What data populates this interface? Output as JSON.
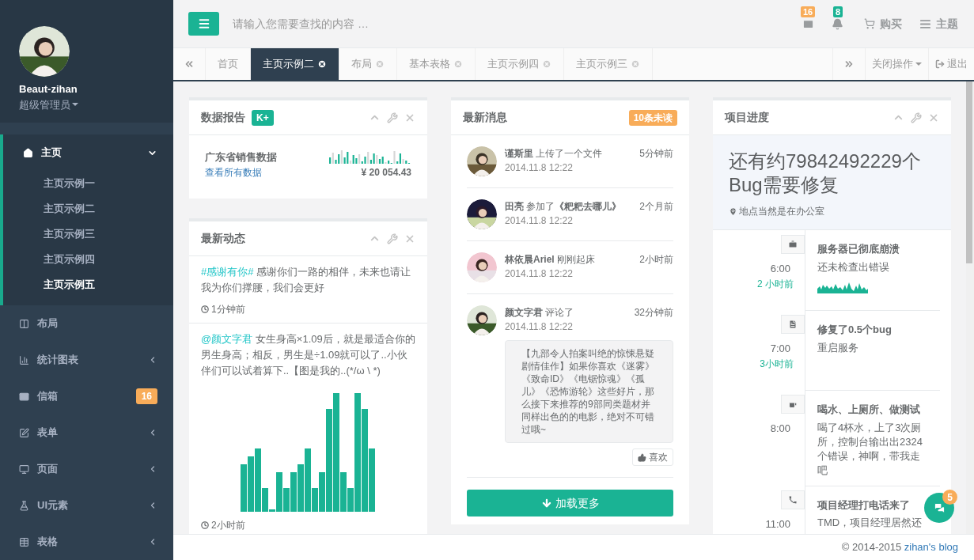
{
  "sidebar": {
    "profile": {
      "name": "Beaut-zihan",
      "role": "超级管理员"
    },
    "items": [
      {
        "label": "主页",
        "selected": true,
        "expanded": true,
        "children": [
          {
            "label": "主页示例一",
            "selected": false
          },
          {
            "label": "主页示例二",
            "selected": false
          },
          {
            "label": "主页示例三",
            "selected": false
          },
          {
            "label": "主页示例四",
            "selected": false
          },
          {
            "label": "主页示例五",
            "selected": true
          }
        ]
      },
      {
        "label": "布局",
        "selected": false,
        "expanded": false
      },
      {
        "label": "统计图表",
        "selected": false,
        "expanded": false,
        "has_arrow": true
      },
      {
        "label": "信箱",
        "selected": false,
        "expanded": false,
        "badge": "16"
      },
      {
        "label": "表单",
        "selected": false,
        "expanded": false,
        "has_arrow": true
      },
      {
        "label": "页面",
        "selected": false,
        "expanded": false,
        "has_arrow": true
      },
      {
        "label": "UI元素",
        "selected": false,
        "expanded": false,
        "has_arrow": true
      },
      {
        "label": "表格",
        "selected": false,
        "expanded": false,
        "has_arrow": true
      }
    ]
  },
  "topbar": {
    "search_placeholder": "请输入您需要查找的内容 …",
    "mail_badge": "16",
    "bell_badge": "8",
    "buy": "购买",
    "theme": "主题"
  },
  "tabs": [
    {
      "label": "首页",
      "selected": false,
      "closable": false
    },
    {
      "label": "主页示例二",
      "selected": true,
      "closable": true
    },
    {
      "label": "布局",
      "selected": false,
      "closable": true
    },
    {
      "label": "基本表格",
      "selected": false,
      "closable": true
    },
    {
      "label": "主页示例四",
      "selected": false,
      "closable": true
    },
    {
      "label": "主页示例三",
      "selected": false,
      "closable": true
    }
  ],
  "tab_actions": {
    "close_menu": "关闭操作",
    "logout": "退出"
  },
  "report": {
    "title": "数据报告",
    "badge": "K+",
    "name": "广东省销售数据",
    "link": "查看所有数据",
    "amount": "¥ 20 054.43"
  },
  "feed": {
    "title": "最新动态",
    "posts": [
      {
        "tag": "#感谢有你#",
        "text": "感谢你们一路的相伴，未来也请让我为你们撑腰，我们会更好",
        "time": "1分钟前",
        "has_chart": false
      },
      {
        "tag": "@颜文字君",
        "text": "女生身高×1.09后，就是最适合你的男生身高；相反，男生是÷1.09就可以了..小伙伴们可以试着算下..【图是我的..(*/ω \\ *)",
        "time": "2小时前",
        "has_chart": true
      }
    ]
  },
  "messages": {
    "title": "最新消息",
    "badge": "10条未读",
    "items": [
      {
        "line": "**谨斯里** 上传了一个文件",
        "date": "2014.11.8 12:22",
        "ago": "5分钟前"
      },
      {
        "line": "**田亮** 参加了**《粑粑去哪儿》**",
        "date": "2014.11.8 12:22",
        "ago": "2个月前"
      },
      {
        "line": "**林依晨Ariel** 刚刚起床",
        "date": "2014.11.8 12:22",
        "ago": "2小时前"
      },
      {
        "line": "**颜文字君** 评论了",
        "date": "2014.11.8 12:22",
        "ago": "32分钟前",
        "quote": "【九部令人拍案叫绝的惊悚悬疑剧情佳作】如果你喜欢《迷雾》《致命ID》《电锯惊魂》《孤儿》《恐怖游轮》这些好片，那么接下来推荐的9部同类题材并同样出色的的电影，绝对不可错过哦~",
        "like": "喜欢"
      }
    ],
    "load_more": "加载更多"
  },
  "progress": {
    "title": "项目进度",
    "headline": "还有约79842492229个Bug需要修复",
    "location": "地点当然是在办公室",
    "events": [
      {
        "time": "6:00",
        "ago": "2 小时前",
        "title": "服务器已彻底崩溃",
        "text": "还未检查出错误",
        "sparkline": true
      },
      {
        "time": "7:00",
        "ago": "3小时前",
        "title": "修复了0.5个bug",
        "text": "重启服务",
        "sparkline": false
      },
      {
        "time": "8:00",
        "title": "喝水、上厕所、做测试",
        "text": "喝了4杯水，上了3次厕所，控制台输出出2324个错误，神啊，带我走吧",
        "sparkline": false
      },
      {
        "time": "11:00",
        "title": "项目经理打电话来了",
        "text": "TMD，项目经理居然还",
        "sparkline": false
      }
    ]
  },
  "chat": {
    "badge": "5"
  },
  "footer": {
    "text": "© 2014-2015",
    "link": "zihan's blog"
  }
}
